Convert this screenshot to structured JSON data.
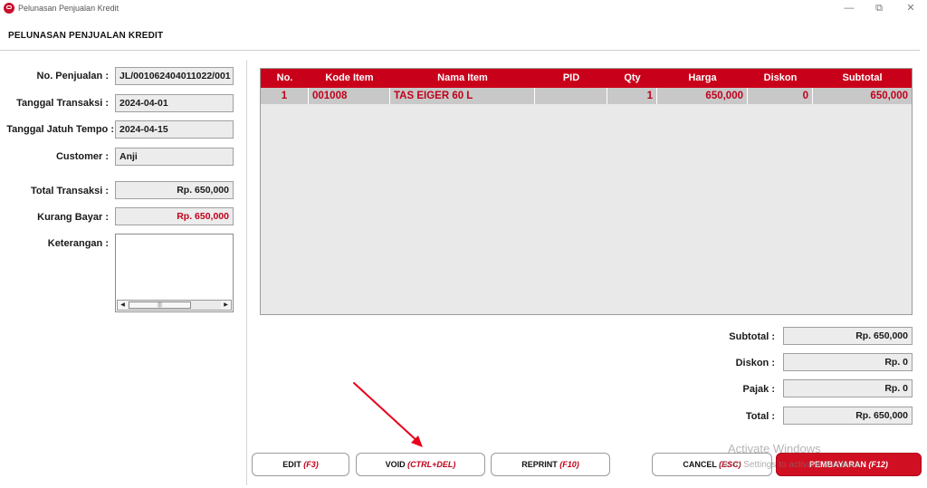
{
  "window": {
    "title": "Pelunasan Penjualan Kredit",
    "controls": {
      "minimize": "—",
      "restore": "⧉",
      "close": "✕"
    }
  },
  "page_title": "PELUNASAN PENJUALAN KREDIT",
  "form": {
    "no_penjualan": {
      "label": "No. Penjualan :",
      "value": "JL/001062404011022/001"
    },
    "tanggal_transaksi": {
      "label": "Tanggal Transaksi :",
      "value": "2024-04-01"
    },
    "tanggal_jatuh_tempo": {
      "label": "Tanggal Jatuh Tempo :",
      "value": "2024-04-15"
    },
    "customer": {
      "label": "Customer :",
      "value": "Anji"
    },
    "total_transaksi": {
      "label": "Total Transaksi :",
      "value": "Rp. 650,000"
    },
    "kurang_bayar": {
      "label": "Kurang Bayar :",
      "value": "Rp. 650,000"
    },
    "keterangan": {
      "label": "Keterangan :",
      "value": ""
    }
  },
  "table": {
    "columns": [
      "No.",
      "Kode Item",
      "Nama Item",
      "PID",
      "Qty",
      "Harga",
      "Diskon",
      "Subtotal"
    ],
    "rows": [
      {
        "no": "1",
        "kode": "001008",
        "nama": "TAS EIGER 60 L",
        "pid": "",
        "qty": "1",
        "harga": "650,000",
        "diskon": "0",
        "subtotal": "650,000"
      }
    ]
  },
  "summary": {
    "subtotal": {
      "label": "Subtotal :",
      "value": "Rp. 650,000"
    },
    "diskon": {
      "label": "Diskon :",
      "value": "Rp. 0"
    },
    "pajak": {
      "label": "Pajak :",
      "value": "Rp. 0"
    },
    "total": {
      "label": "Total :",
      "value": "Rp. 650,000"
    }
  },
  "buttons": {
    "edit": {
      "label": "EDIT ",
      "key": "(F3)"
    },
    "void": {
      "label": "VOID ",
      "key": "(CTRL+DEL)"
    },
    "reprint": {
      "label": "REPRINT ",
      "key": "(F10)"
    },
    "cancel": {
      "label": "CANCEL ",
      "key": "(ESC)"
    },
    "pembayaran": {
      "label": "PEMBAYARAN ",
      "key": "(F12)"
    }
  },
  "watermark": {
    "line1": "Activate Windows",
    "line2": "Go to Settings to activate Windows."
  },
  "colors": {
    "accent": "#c9001a",
    "row_bg": "#c8c8c8",
    "annotation_arrow": "#e8001c"
  }
}
